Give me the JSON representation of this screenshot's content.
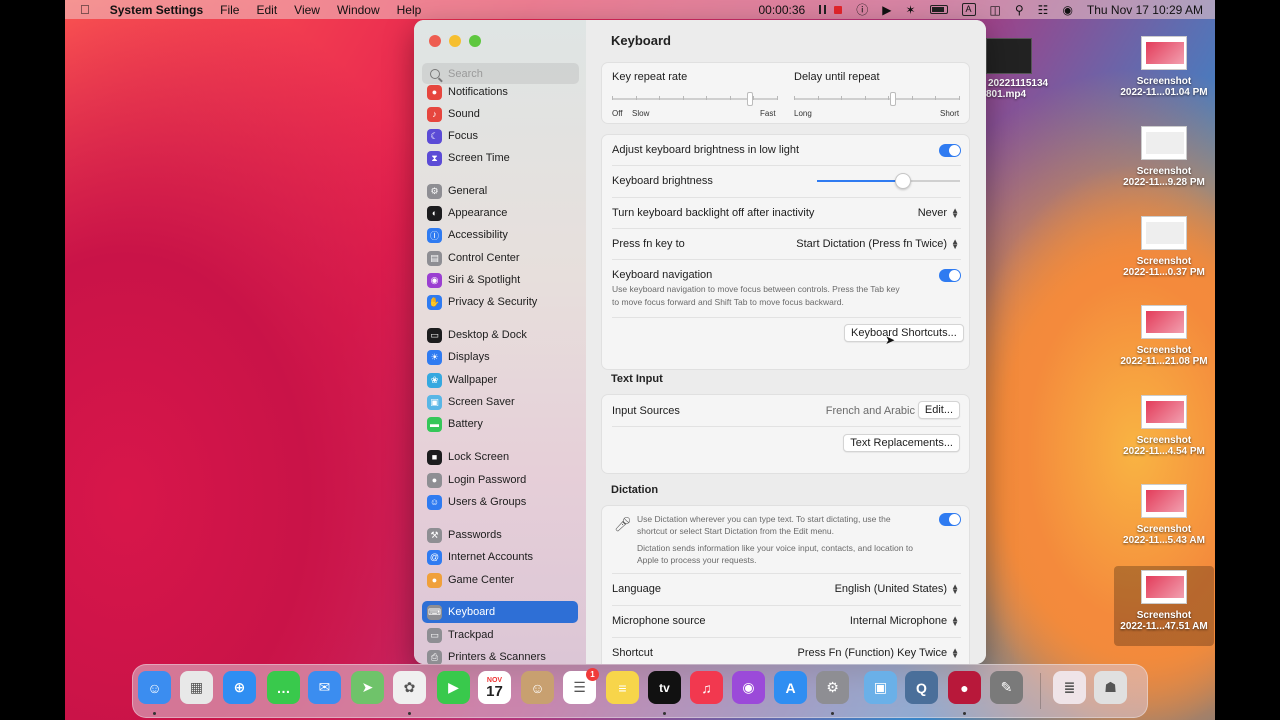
{
  "menubar": {
    "app_name": "System Settings",
    "menus": [
      "File",
      "Edit",
      "View",
      "Window",
      "Help"
    ],
    "timer": "00:00:36",
    "clock": "Thu Nov 17  10:29 AM",
    "input_indicator": "A"
  },
  "sidebar": {
    "search_placeholder": "Search",
    "items": [
      {
        "label": "Notifications",
        "color": "#e6463e",
        "glyph": "●"
      },
      {
        "label": "Sound",
        "color": "#e6463e",
        "glyph": "♪"
      },
      {
        "label": "Focus",
        "color": "#5b4bd6",
        "glyph": "☾"
      },
      {
        "label": "Screen Time",
        "color": "#5b4bd6",
        "glyph": "⧗"
      },
      {
        "label": "General",
        "color": "#8e8e93",
        "glyph": "⚙"
      },
      {
        "label": "Appearance",
        "color": "#1c1c1e",
        "glyph": "◐"
      },
      {
        "label": "Accessibility",
        "color": "#2f7bf1",
        "glyph": "Ⓘ"
      },
      {
        "label": "Control Center",
        "color": "#8e8e93",
        "glyph": "▤"
      },
      {
        "label": "Siri & Spotlight",
        "color": "#9b3fd1",
        "glyph": "◉"
      },
      {
        "label": "Privacy & Security",
        "color": "#2f7bf1",
        "glyph": "✋"
      },
      {
        "label": "Desktop & Dock",
        "color": "#1c1c1e",
        "glyph": "▭"
      },
      {
        "label": "Displays",
        "color": "#2f7bf1",
        "glyph": "☀"
      },
      {
        "label": "Wallpaper",
        "color": "#35a8e0",
        "glyph": "❀"
      },
      {
        "label": "Screen Saver",
        "color": "#58b6e6",
        "glyph": "▣"
      },
      {
        "label": "Battery",
        "color": "#35c759",
        "glyph": "▬"
      },
      {
        "label": "Lock Screen",
        "color": "#1c1c1e",
        "glyph": "■"
      },
      {
        "label": "Login Password",
        "color": "#8e8e93",
        "glyph": "●"
      },
      {
        "label": "Users & Groups",
        "color": "#2f7bf1",
        "glyph": "☺"
      },
      {
        "label": "Passwords",
        "color": "#8e8e93",
        "glyph": "⚒"
      },
      {
        "label": "Internet Accounts",
        "color": "#2f7bf1",
        "glyph": "@"
      },
      {
        "label": "Game Center",
        "color": "#f0a03a",
        "glyph": "●"
      },
      {
        "label": "Keyboard",
        "color": "#8e8e93",
        "glyph": "⌨"
      },
      {
        "label": "Trackpad",
        "color": "#8e8e93",
        "glyph": "▭"
      },
      {
        "label": "Printers & Scanners",
        "color": "#8e8e93",
        "glyph": "⎙"
      }
    ],
    "active": "Keyboard"
  },
  "content": {
    "title": "Keyboard",
    "key_repeat_label": "Key repeat rate",
    "key_repeat_left": "Off",
    "key_repeat_left2": "Slow",
    "key_repeat_right": "Fast",
    "delay_label": "Delay until repeat",
    "delay_left": "Long",
    "delay_right": "Short",
    "adjust_brightness_label": "Adjust keyboard brightness in low light",
    "keyboard_brightness_label": "Keyboard brightness",
    "brightness_level": 0.6,
    "backlight_off_label": "Turn keyboard backlight off after inactivity",
    "backlight_off_value": "Never",
    "fn_key_label": "Press fn key to",
    "fn_key_value": "Start Dictation (Press fn Twice)",
    "keyboard_nav_label": "Keyboard navigation",
    "keyboard_nav_desc1": "Use keyboard navigation to move focus between controls. Press the Tab key",
    "keyboard_nav_desc2": "to move focus forward and Shift Tab to move focus backward.",
    "shortcuts_button": "Keyboard Shortcuts...",
    "text_input_title": "Text Input",
    "input_sources_label": "Input Sources",
    "input_sources_value": "French and Arabic",
    "edit_button": "Edit...",
    "text_replacements_button": "Text Replacements...",
    "dictation_title": "Dictation",
    "dictation_desc1": "Use Dictation wherever you can type text. To start dictating, use the",
    "dictation_desc2": "shortcut or select Start Dictation from the Edit menu.",
    "dictation_desc3": "Dictation sends information like your voice input, contacts, and location to",
    "dictation_desc4": "Apple to process your requests.",
    "language_label": "Language",
    "language_value": "English (United States)",
    "mic_label": "Microphone source",
    "mic_value": "Internal Microphone",
    "shortcut_label": "Shortcut",
    "shortcut_value": "Press Fn (Function) Key Twice"
  },
  "desktop": {
    "video_name1": "20221115134",
    "video_name2": "801.mp4",
    "shots": [
      {
        "title": "Screenshot",
        "sub": "2022-11...01.04 PM"
      },
      {
        "title": "Screenshot",
        "sub": "2022-11...9.28 PM"
      },
      {
        "title": "Screenshot",
        "sub": "2022-11...0.37 PM"
      },
      {
        "title": "Screenshot",
        "sub": "2022-11...21.08 PM"
      },
      {
        "title": "Screenshot",
        "sub": "2022-11...4.54 PM"
      },
      {
        "title": "Screenshot",
        "sub": "2022-11...5.43 AM"
      },
      {
        "title": "Screenshot",
        "sub": "2022-11...47.51 AM"
      }
    ]
  },
  "dock": {
    "calendar_month": "NOV",
    "calendar_day": "17",
    "reminders_badge": "1",
    "tv_label": "tv",
    "apps": [
      {
        "name": "finder-icon",
        "color": "#3b8df0",
        "glyph": "☺"
      },
      {
        "name": "launchpad-icon",
        "color": "#e8e8e8",
        "glyph": "▦"
      },
      {
        "name": "safari-icon",
        "color": "#2f8ef2",
        "glyph": "⊕"
      },
      {
        "name": "messages-icon",
        "color": "#39c94c",
        "glyph": "…"
      },
      {
        "name": "mail-icon",
        "color": "#3b8df0",
        "glyph": "✉"
      },
      {
        "name": "maps-icon",
        "color": "#6fc36a",
        "glyph": "➤"
      },
      {
        "name": "photos-icon",
        "color": "#f0f0f0",
        "glyph": "✿"
      },
      {
        "name": "facetime-icon",
        "color": "#39c94c",
        "glyph": "▶"
      },
      {
        "name": "calendar-icon",
        "color": "#ffffff",
        "glyph": ""
      },
      {
        "name": "contacts-icon",
        "color": "#c8a070",
        "glyph": "☺"
      },
      {
        "name": "reminders-icon",
        "color": "#ffffff",
        "glyph": "☰"
      },
      {
        "name": "notes-icon",
        "color": "#f7d54a",
        "glyph": "≡"
      },
      {
        "name": "tv-icon",
        "color": "#111111",
        "glyph": ""
      },
      {
        "name": "music-icon",
        "color": "#f2384f",
        "glyph": "♫"
      },
      {
        "name": "podcasts-icon",
        "color": "#9b4ad9",
        "glyph": "◉"
      },
      {
        "name": "app-store-icon",
        "color": "#2f8ef2",
        "glyph": "A"
      },
      {
        "name": "system-settings-icon",
        "color": "#8e8e93",
        "glyph": "⚙"
      },
      {
        "name": "preview-icon",
        "color": "#6ab0e8",
        "glyph": "▣"
      },
      {
        "name": "quicktime-icon",
        "color": "#4a6f9a",
        "glyph": "Q"
      },
      {
        "name": "screen-recorder-icon",
        "color": "#b8183a",
        "glyph": "●"
      },
      {
        "name": "script-editor-icon",
        "color": "#7a7a7a",
        "glyph": "✎"
      },
      {
        "name": "documents-icon",
        "color": "#efe4e8",
        "glyph": "≣"
      },
      {
        "name": "trash-icon",
        "color": "#e0e0e0",
        "glyph": "☗"
      }
    ]
  }
}
